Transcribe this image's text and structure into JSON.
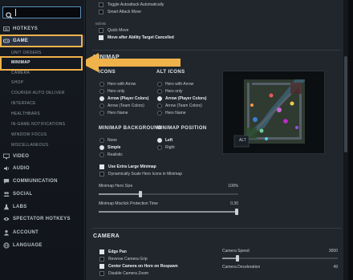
{
  "search": {
    "placeholder": "",
    "value": ""
  },
  "sidebar": {
    "items": [
      {
        "label": "HOTKEYS",
        "icon": "keyboard-icon"
      },
      {
        "label": "GAME",
        "icon": "gamepad-icon"
      },
      {
        "label": "VIDEO",
        "icon": "monitor-icon"
      },
      {
        "label": "AUDIO",
        "icon": "speaker-icon"
      },
      {
        "label": "COMMUNICATION",
        "icon": "chat-icon"
      },
      {
        "label": "SOCIAL",
        "icon": "people-icon"
      },
      {
        "label": "LABS",
        "icon": "flask-icon"
      },
      {
        "label": "SPECTATOR HOTKEYS",
        "icon": "eye-icon"
      },
      {
        "label": "ACCOUNT",
        "icon": "user-icon"
      },
      {
        "label": "LANGUAGE",
        "icon": "globe-icon"
      }
    ],
    "game_sub": [
      "UNIT ORDERS",
      "MINIMAP",
      "CAMERA",
      "SHOP",
      "COURIER AUTO DELIVER",
      "INTERFACE",
      "HEALTHBARS",
      "IN-GAME NOTIFICATIONS",
      "WINDOW FOCUS",
      "MISCELLANEOUS"
    ]
  },
  "top_options": {
    "toggle_autoattack": "Toggle Autoattack Automatically",
    "smart_attack_move": "Smart Attack Move",
    "move_header": "MOVE",
    "quick_move": "Quick Move",
    "move_after_ability": "Move after Ability Target Cancelled"
  },
  "minimap": {
    "section_title": "MINIMAP",
    "icons_header": "ICONS",
    "icons_options": [
      "Hero with Arrow",
      "Hero only",
      "Arrow (Player Colors)",
      "Arrow (Team Colors)",
      "Hero Name"
    ],
    "icons_selected": 2,
    "alt_icons_header": "ALT ICONS",
    "alt_icons_options": [
      "Hero with Arrow",
      "Hero only",
      "Arrow (Player Colors)",
      "Arrow (Team Colors)",
      "Hero Name"
    ],
    "alt_icons_selected": 2,
    "background_header": "MINIMAP BACKGROUND",
    "background_options": [
      "None",
      "Simple",
      "Realistic"
    ],
    "background_selected": 1,
    "position_header": "MINIMAP POSITION",
    "position_options": [
      "Left",
      "Right"
    ],
    "position_selected": 0,
    "extra_large": "Use Extra Large Minimap",
    "dynamic_scale": "Dynamically Scale Hero Icons in Minimap",
    "hero_size_label": "Minimap Hero Size",
    "hero_size_value": "100%",
    "hero_size_fraction": 0.3,
    "misclick_label": "Minimap Misclick Protection Time",
    "misclick_value": "0.30",
    "misclick_fraction": 1.0,
    "preview_tag": "ALT"
  },
  "camera": {
    "section_title": "CAMERA",
    "edge_pan": "Edge Pan",
    "reverse_grip": "Reverse Camera Grip",
    "center_on_respawn": "Center Camera on Hero on Respawn",
    "disable_zoom": "Disable Camera Zoom",
    "speed_label": "Camera Speed",
    "speed_value": "3000",
    "speed_fraction": 0.13,
    "decel_label": "Camera Deceleration",
    "decel_value": "49"
  },
  "colors": {
    "highlight": "#f0b24a",
    "accent": "#5b8fb9"
  }
}
